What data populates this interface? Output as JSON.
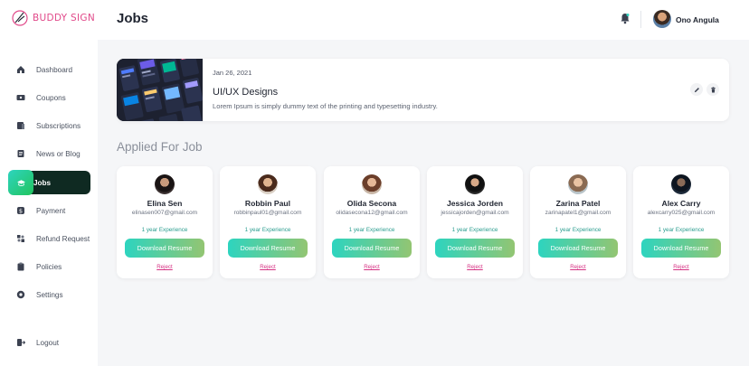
{
  "brand": {
    "logo_text": "BUDDY SIGN"
  },
  "sidebar": {
    "items": [
      {
        "label": "Dashboard",
        "icon": "home-icon"
      },
      {
        "label": "Coupons",
        "icon": "coupon-icon"
      },
      {
        "label": "Subscriptions",
        "icon": "subscription-icon"
      },
      {
        "label": "News or Blog",
        "icon": "news-icon"
      },
      {
        "label": "Jobs",
        "icon": "jobs-icon",
        "active": true
      },
      {
        "label": "Payment",
        "icon": "dollar-icon"
      },
      {
        "label": "Refund Request",
        "icon": "refund-icon"
      },
      {
        "label": "Policies",
        "icon": "policies-icon"
      },
      {
        "label": "Settings",
        "icon": "gear-icon"
      },
      {
        "label": "Logout",
        "icon": "logout-icon"
      }
    ]
  },
  "header": {
    "title": "Jobs",
    "user_name": "Ono Angula"
  },
  "job": {
    "date": "Jan 26, 2021",
    "title": "UI/UX Designs",
    "description": "Lorem Ipsum is simply dummy text of the printing and typesetting industry."
  },
  "applied": {
    "title": "Applied For Job",
    "download_label": "Download Resume",
    "reject_label": "Reject",
    "applicants": [
      {
        "name": "Elina Sen",
        "email": "elinasen007@gmail.com",
        "experience": "1 year Experience"
      },
      {
        "name": "Robbin Paul",
        "email": "robbinpaul01@gmail.com",
        "experience": "1 year Experience"
      },
      {
        "name": "Olida Secona",
        "email": "olidasecona12@gmail.com",
        "experience": "1 year Experience"
      },
      {
        "name": "Jessica Jorden",
        "email": "jessicajorden@gmail.com",
        "experience": "1 year Experience"
      },
      {
        "name": "Zarina Patel",
        "email": "zarinapatel1@gmail.com",
        "experience": "1 year Experience"
      },
      {
        "name": "Alex Carry",
        "email": "alexcarry025@gmail.com",
        "experience": "1 year Experience"
      }
    ]
  },
  "colors": {
    "accent_start": "#2dd4bf",
    "accent_end": "#93c572",
    "active_nav_bg": "#0f2a22",
    "reject": "#d63384",
    "brand": "#e14a8a"
  }
}
